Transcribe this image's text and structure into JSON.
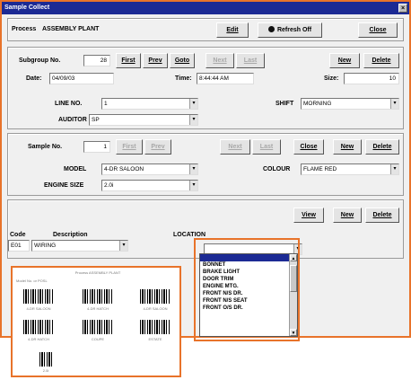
{
  "window": {
    "title": "Sample Collect",
    "close_glyph": "×"
  },
  "header": {
    "process_label": "Process",
    "process_value": "ASSEMBLY PLANT",
    "edit_label": "Edit",
    "refresh_label": "Refresh Off",
    "close_label": "Close"
  },
  "subgroup": {
    "no_label": "Subgroup No.",
    "no_value": "28",
    "first": "First",
    "prev": "Prev",
    "goto": "Goto",
    "next": "Next",
    "last": "Last",
    "new": "New",
    "delete": "Delete",
    "date_label": "Date:",
    "date_value": "04/09/03",
    "time_label": "Time:",
    "time_value": "8:44:44 AM",
    "size_label": "Size:",
    "size_value": "10",
    "line_label": "LINE NO.",
    "line_value": "1",
    "shift_label": "SHIFT",
    "shift_value": "MORNING",
    "auditor_label": "AUDITOR",
    "auditor_value": "SP"
  },
  "sample": {
    "no_label": "Sample No.",
    "no_value": "1",
    "first": "First",
    "prev": "Prev",
    "next": "Next",
    "last": "Last",
    "close": "Close",
    "new": "New",
    "delete": "Delete",
    "model_label": "MODEL",
    "model_value": "4-DR SALOON",
    "colour_label": "COLOUR",
    "colour_value": "FLAME RED",
    "engine_label": "ENGINE SIZE",
    "engine_value": "2.0i"
  },
  "defect": {
    "view": "View",
    "new": "New",
    "delete": "Delete",
    "code_label": "Code",
    "code_value": "E01",
    "desc_label": "Description",
    "desc_value": "WIRING",
    "location_label": "LOCATION",
    "location_value": ""
  },
  "location_list": [
    "",
    "BONNET",
    "BRAKE LIGHT",
    "DOOR TRIM",
    "ENGINE MTG.",
    "FRONT N/S DR.",
    "FRONT N/S SEAT",
    "FRONT O/S DR."
  ],
  "barcode_sheet": {
    "title": "Process ASSEMBLY PLANT",
    "subtitle": "Model No. or POSL",
    "captions": [
      "4-DR SALOON",
      "4-DR HATCH",
      "4-DR SALOON",
      "4-DR HATCH",
      "COUPE",
      "ESTATE",
      "2.0i"
    ]
  },
  "colors": {
    "accent": "#e8732a",
    "titlebar": "#1c2a94"
  }
}
